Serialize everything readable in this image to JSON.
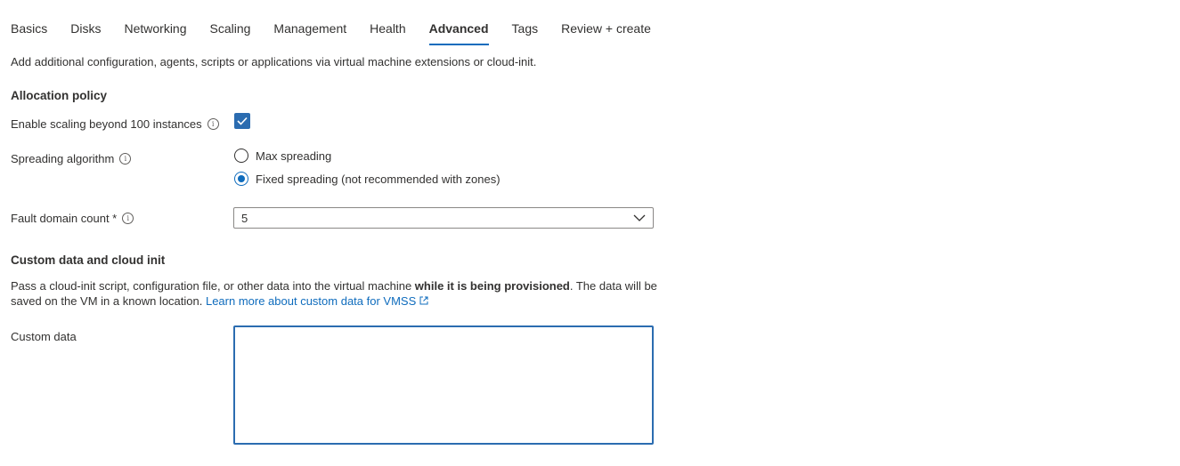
{
  "tabs": [
    {
      "label": "Basics"
    },
    {
      "label": "Disks"
    },
    {
      "label": "Networking"
    },
    {
      "label": "Scaling"
    },
    {
      "label": "Management"
    },
    {
      "label": "Health"
    },
    {
      "label": "Advanced",
      "active": true
    },
    {
      "label": "Tags"
    },
    {
      "label": "Review + create"
    }
  ],
  "description": "Add additional configuration, agents, scripts or applications via virtual machine extensions or cloud-init.",
  "allocation": {
    "heading": "Allocation policy",
    "scaling_label": "Enable scaling beyond 100 instances",
    "scaling_checked": true,
    "spreading_label": "Spreading algorithm",
    "spreading_options": [
      "Max spreading",
      "Fixed spreading (not recommended with zones)"
    ],
    "spreading_selected": "Fixed spreading (not recommended with zones)",
    "fault_label": "Fault domain count *",
    "fault_value": "5"
  },
  "custom_data": {
    "heading": "Custom data and cloud init",
    "para_part1": "Pass a cloud-init script, configuration file, or other data into the virtual machine ",
    "para_bold": "while it is being provisioned",
    "para_part2": ". The data will be saved on the VM in a known location. ",
    "link_text": "Learn more about custom data for VMSS",
    "field_label": "Custom data",
    "field_value": ""
  },
  "icons": {
    "info": "info-icon",
    "check": "checkmark-icon",
    "chevron": "chevron-down-icon",
    "external": "external-link-icon"
  },
  "colors": {
    "accent": "#0f6cbd",
    "checkbox": "#2b6cb0",
    "text": "#323130"
  }
}
